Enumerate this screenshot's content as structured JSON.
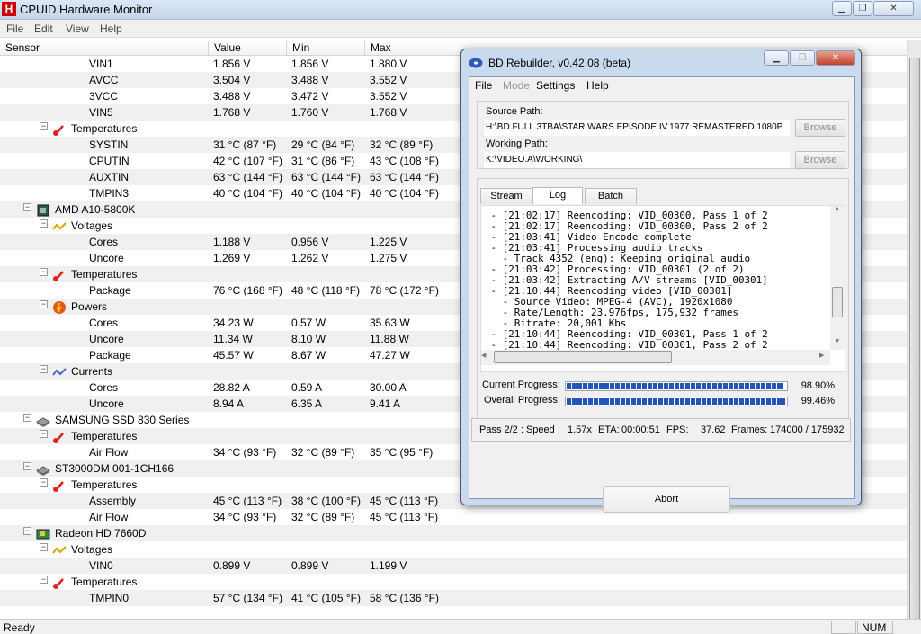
{
  "window": {
    "title": "CPUID Hardware Monitor",
    "app_icon_letter": "H"
  },
  "menu": [
    "File",
    "Edit",
    "View",
    "Help"
  ],
  "columns": [
    "Sensor",
    "Value",
    "Min",
    "Max"
  ],
  "rows": [
    {
      "level": 3,
      "label": "VIN1",
      "value": "1.856 V",
      "min": "1.856 V",
      "max": "1.880 V"
    },
    {
      "level": 3,
      "label": "AVCC",
      "value": "3.504 V",
      "min": "3.488 V",
      "max": "3.552 V"
    },
    {
      "level": 3,
      "label": "3VCC",
      "value": "3.488 V",
      "min": "3.472 V",
      "max": "3.552 V"
    },
    {
      "level": 3,
      "label": "VIN5",
      "value": "1.768 V",
      "min": "1.760 V",
      "max": "1.768 V"
    },
    {
      "level": 2,
      "label": "Temperatures",
      "icon": "thermometer-icon",
      "value": "",
      "min": "",
      "max": ""
    },
    {
      "level": 3,
      "label": "SYSTIN",
      "value": "31 °C (87 °F)",
      "min": "29 °C (84 °F)",
      "max": "32 °C (89 °F)"
    },
    {
      "level": 3,
      "label": "CPUTIN",
      "value": "42 °C (107 °F)",
      "min": "31 °C (86 °F)",
      "max": "43 °C (108 °F)"
    },
    {
      "level": 3,
      "label": "AUXTIN",
      "value": "63 °C (144 °F)",
      "min": "63 °C (144 °F)",
      "max": "63 °C (144 °F)"
    },
    {
      "level": 3,
      "label": "TMPIN3",
      "value": "40 °C (104 °F)",
      "min": "40 °C (104 °F)",
      "max": "40 °C (104 °F)"
    },
    {
      "level": 1,
      "label": "AMD A10-5800K",
      "icon": "cpu-chip-icon",
      "value": "",
      "min": "",
      "max": ""
    },
    {
      "level": 2,
      "label": "Voltages",
      "icon": "voltage-icon",
      "value": "",
      "min": "",
      "max": ""
    },
    {
      "level": 3,
      "label": "Cores",
      "value": "1.188 V",
      "min": "0.956 V",
      "max": "1.225 V"
    },
    {
      "level": 3,
      "label": "Uncore",
      "value": "1.269 V",
      "min": "1.262 V",
      "max": "1.275 V"
    },
    {
      "level": 2,
      "label": "Temperatures",
      "icon": "thermometer-icon",
      "value": "",
      "min": "",
      "max": ""
    },
    {
      "level": 3,
      "label": "Package",
      "value": "76 °C (168 °F)",
      "min": "48 °C (118 °F)",
      "max": "78 °C (172 °F)"
    },
    {
      "level": 2,
      "label": "Powers",
      "icon": "power-icon",
      "value": "",
      "min": "",
      "max": ""
    },
    {
      "level": 3,
      "label": "Cores",
      "value": "34.23 W",
      "min": "0.57 W",
      "max": "35.63 W"
    },
    {
      "level": 3,
      "label": "Uncore",
      "value": "11.34 W",
      "min": "8.10 W",
      "max": "11.88 W"
    },
    {
      "level": 3,
      "label": "Package",
      "value": "45.57 W",
      "min": "8.67 W",
      "max": "47.27 W"
    },
    {
      "level": 2,
      "label": "Currents",
      "icon": "current-icon",
      "value": "",
      "min": "",
      "max": ""
    },
    {
      "level": 3,
      "label": "Cores",
      "value": "28.82 A",
      "min": "0.59 A",
      "max": "30.00 A"
    },
    {
      "level": 3,
      "label": "Uncore",
      "value": "8.94 A",
      "min": "6.35 A",
      "max": "9.41 A"
    },
    {
      "level": 1,
      "label": "SAMSUNG SSD 830 Series",
      "icon": "hard-drive-icon",
      "value": "",
      "min": "",
      "max": ""
    },
    {
      "level": 2,
      "label": "Temperatures",
      "icon": "thermometer-icon",
      "value": "",
      "min": "",
      "max": ""
    },
    {
      "level": 3,
      "label": "Air Flow",
      "value": "34 °C (93 °F)",
      "min": "32 °C (89 °F)",
      "max": "35 °C (95 °F)"
    },
    {
      "level": 1,
      "label": "ST3000DM 001-1CH166",
      "icon": "hard-drive-icon",
      "value": "",
      "min": "",
      "max": ""
    },
    {
      "level": 2,
      "label": "Temperatures",
      "icon": "thermometer-icon",
      "value": "",
      "min": "",
      "max": ""
    },
    {
      "level": 3,
      "label": "Assembly",
      "value": "45 °C (113 °F)",
      "min": "38 °C (100 °F)",
      "max": "45 °C (113 °F)"
    },
    {
      "level": 3,
      "label": "Air Flow",
      "value": "34 °C (93 °F)",
      "min": "32 °C (89 °F)",
      "max": "45 °C (113 °F)"
    },
    {
      "level": 1,
      "label": "Radeon HD 7660D",
      "icon": "gpu-icon",
      "value": "",
      "min": "",
      "max": ""
    },
    {
      "level": 2,
      "label": "Voltages",
      "icon": "voltage-icon",
      "value": "",
      "min": "",
      "max": ""
    },
    {
      "level": 3,
      "label": "VIN0",
      "value": "0.899 V",
      "min": "0.899 V",
      "max": "1.199 V"
    },
    {
      "level": 2,
      "label": "Temperatures",
      "icon": "thermometer-icon",
      "value": "",
      "min": "",
      "max": ""
    },
    {
      "level": 3,
      "label": "TMPIN0",
      "value": "57 °C (134 °F)",
      "min": "41 °C (105 °F)",
      "max": "58 °C (136 °F)"
    }
  ],
  "status": {
    "text": "Ready",
    "num": "NUM"
  },
  "dialog": {
    "title": "BD Rebuilder, v0.42.08 (beta)",
    "menu": [
      "File",
      "Mode",
      "Settings",
      "Help"
    ],
    "source_label": "Source Path:",
    "source_value": "H:\\BD.FULL.3TBA\\STAR.WARS.EPISODE.IV.1977.REMASTERED.1080P",
    "working_label": "Working Path:",
    "working_value": "K:\\VIDEO.A\\WORKING\\",
    "browse_label": "Browse",
    "tabs": [
      "Stream",
      "Log",
      "Batch"
    ],
    "log": [
      " - [21:02:17] Reencoding: VID_00300, Pass 1 of 2",
      " - [21:02:17] Reencoding: VID_00300, Pass 2 of 2",
      " - [21:03:41] Video Encode complete",
      " - [21:03:41] Processing audio tracks",
      "   - Track 4352 (eng): Keeping original audio",
      " - [21:03:42] Processing: VID_00301 (2 of 2)",
      " - [21:03:42] Extracting A/V streams [VID_00301]",
      " - [21:10:44] Reencoding video [VID_00301]",
      "   - Source Video: MPEG-4 (AVC), 1920x1080",
      "   - Rate/Length: 23.976fps, 175,932 frames",
      "   - Bitrate: 20,001 Kbs",
      " - [21:10:44] Reencoding: VID_00301, Pass 1 of 2",
      " - [21:10:44] Reencoding: VID_00301, Pass 2 of 2"
    ],
    "current_progress_label": "Current Progress:",
    "current_progress_text": "98.90%",
    "current_progress": 0.989,
    "overall_progress_label": "Overall Progress:",
    "overall_progress_text": "99.46%",
    "overall_progress": 0.9946,
    "stats": {
      "pass": "Pass 2/2 : Speed :",
      "speed": "1.57x",
      "eta_label": "ETA:",
      "eta": "00:00:51",
      "fps_label": "FPS:",
      "fps": "37.62",
      "frames_label": "Frames:",
      "frames": "174000 / 175932"
    },
    "abort_label": "Abort"
  }
}
